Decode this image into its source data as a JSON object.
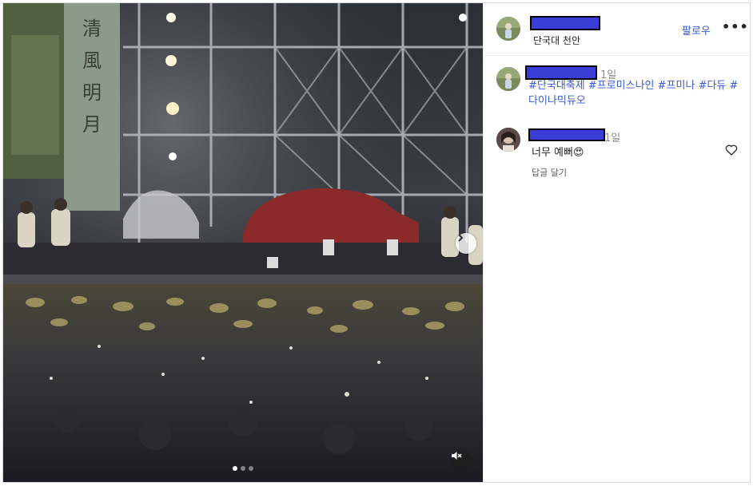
{
  "post": {
    "location": "단국대 천안",
    "follow_label": "팔로우",
    "more_label": "•••",
    "media": {
      "slide_count": 3,
      "active_slide": 1
    }
  },
  "caption": {
    "time": "1일",
    "hashtags": [
      "#단국대축제",
      "#프로미스나인",
      "#프미나",
      "#다듀",
      "#다이나믹듀오"
    ]
  },
  "comment": {
    "time": "1일",
    "text": "너무 예뻐😍",
    "reply_label": "답글 달기"
  }
}
